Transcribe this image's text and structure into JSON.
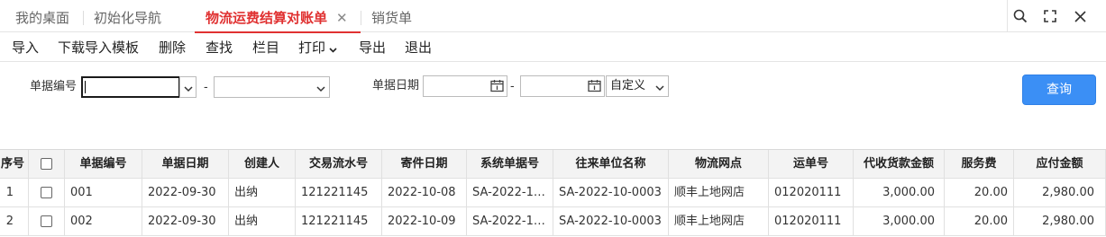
{
  "tabs": [
    {
      "label": "我的桌面",
      "active": false
    },
    {
      "label": "初始化导航",
      "active": false
    },
    {
      "label": "物流运费结算对账单",
      "active": true
    },
    {
      "label": "销货单",
      "active": false
    }
  ],
  "tab_close_glyph": "✕",
  "window_controls": [
    "search-icon",
    "fullscreen-icon",
    "close-icon"
  ],
  "menu": {
    "import": "导入",
    "download_template": "下载导入模板",
    "delete": "删除",
    "find": "查找",
    "columns": "栏目",
    "print": "打印",
    "export": "导出",
    "exit": "退出"
  },
  "filter": {
    "doc_no_label": "单据编号",
    "doc_no_from": "",
    "doc_no_to": "",
    "dash": "-",
    "doc_date_label": "单据日期",
    "date_from": "",
    "date_to": "",
    "date_range_option": "自定义",
    "query_button": "查询"
  },
  "colors": {
    "accent_red": "#e03131",
    "primary_blue": "#3b8ff5"
  },
  "table": {
    "columns": [
      "序号",
      "",
      "单据编号",
      "单据日期",
      "创建人",
      "交易流水号",
      "寄件日期",
      "系统单据号",
      "往来单位名称",
      "物流网点",
      "运单号",
      "代收货款金额",
      "服务费",
      "应付金额"
    ],
    "rows": [
      {
        "seq": "1",
        "doc_no": "001",
        "doc_date": "2022-09-30",
        "creator": "出纳",
        "txn_no": "121221145",
        "ship_date": "2022-10-08",
        "sys_no": "SA-2022-1…",
        "partner": "SA-2022-10-0003",
        "outlet": "顺丰上地网店",
        "waybill": "012020111",
        "cod_amount": "3,000.00",
        "fee": "20.00",
        "payable": "2,980.00"
      },
      {
        "seq": "2",
        "doc_no": "002",
        "doc_date": "2022-09-30",
        "creator": "出纳",
        "txn_no": "121221145",
        "ship_date": "2022-10-09",
        "sys_no": "SA-2022-1…",
        "partner": "SA-2022-10-0003",
        "outlet": "顺丰上地网店",
        "waybill": "012020111",
        "cod_amount": "3,000.00",
        "fee": "20.00",
        "payable": "2,980.00"
      }
    ]
  }
}
